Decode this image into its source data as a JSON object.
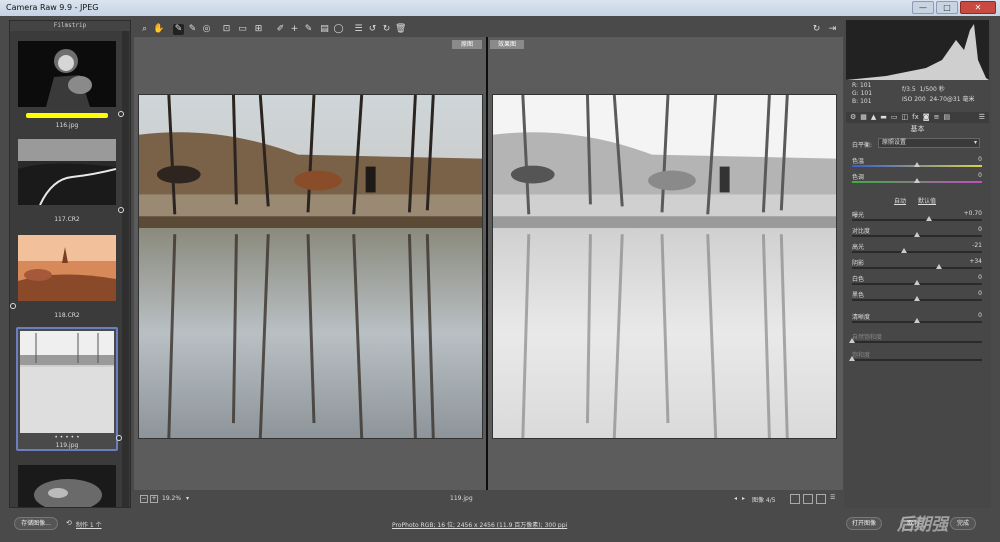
{
  "window": {
    "title": "Camera Raw 9.9 -  JPEG",
    "minimize": "—",
    "maximize": "□",
    "close": "✕"
  },
  "filmstrip": {
    "header": "Filmstrip",
    "items": [
      {
        "name": "116.jpg",
        "stars": "",
        "rating_bar": true
      },
      {
        "name": "117.CR2",
        "stars": ""
      },
      {
        "name": "118.CR2",
        "stars": ""
      },
      {
        "name": "119.jpg",
        "stars": "• • • • •",
        "selected": true
      }
    ]
  },
  "toolbar": {
    "tools": [
      "zoom-tool",
      "hand-tool",
      "white-balance-tool",
      "color-sampler-tool",
      "targeted-adjustment-tool",
      "crop-tool",
      "straighten-tool",
      "transform-tool",
      "spot-removal-tool",
      "red-eye-tool",
      "adjustment-brush-tool",
      "graduated-filter-tool",
      "radial-filter-tool",
      "preferences-tool",
      "rotate-left-tool",
      "rotate-right-tool",
      "trash-tool"
    ],
    "right_tools": [
      "cycle-views-tool",
      "fullscreen-tool"
    ]
  },
  "canvas": {
    "before_label": "原图",
    "after_label": "效果图"
  },
  "status": {
    "zoom": "19.2%",
    "filename": "119.jpg",
    "image_count": "图像 4/5",
    "minus": "−",
    "plus": "+"
  },
  "bottom": {
    "save_button": "存储图像...",
    "copy_label": "制作 1 个",
    "workflow_link": "ProPhoto RGB; 16 位; 2456 x 2456 (11.9 百万像素); 300 ppi",
    "open_button": "打开图像",
    "cancel_button": "取消",
    "done_button": "完成",
    "watermark": "后期强"
  },
  "info": {
    "r_label": "R:",
    "r_value": "101",
    "g_label": "G:",
    "g_value": "101",
    "b_label": "B:",
    "b_value": "101",
    "aperture": "f/3.5",
    "shutter": "1/500 秒",
    "iso": "ISO 200",
    "lens": "24-70@31 毫米"
  },
  "basic": {
    "title": "基本",
    "wb_label": "白平衡:",
    "wb_value": "原照设置",
    "auto_label": "自动",
    "default_label": "默认值",
    "sliders": [
      {
        "name": "色温",
        "value": "0",
        "pos": 0.5,
        "track": "temp"
      },
      {
        "name": "色调",
        "value": "0",
        "pos": 0.5,
        "track": "tint"
      },
      {
        "name": "曝光",
        "value": "+0.70",
        "pos": 0.59,
        "track": "plain"
      },
      {
        "name": "对比度",
        "value": "0",
        "pos": 0.5,
        "track": "plain"
      },
      {
        "name": "高光",
        "value": "-21",
        "pos": 0.4,
        "track": "plain"
      },
      {
        "name": "阴影",
        "value": "+34",
        "pos": 0.67,
        "track": "plain"
      },
      {
        "name": "白色",
        "value": "0",
        "pos": 0.5,
        "track": "plain"
      },
      {
        "name": "黑色",
        "value": "0",
        "pos": 0.5,
        "track": "plain"
      },
      {
        "name": "清晰度",
        "value": "0",
        "pos": 0.5,
        "track": "plain"
      },
      {
        "name": "自然饱和度",
        "value": "",
        "pos": 0.0,
        "track": "plain",
        "dim": true
      },
      {
        "name": "饱和度",
        "value": "",
        "pos": 0.0,
        "track": "plain",
        "dim": true
      }
    ]
  },
  "colors": {
    "selected_border": "#6a7fc0",
    "rating_yellow": "#ffff00",
    "panel": "#474747"
  }
}
